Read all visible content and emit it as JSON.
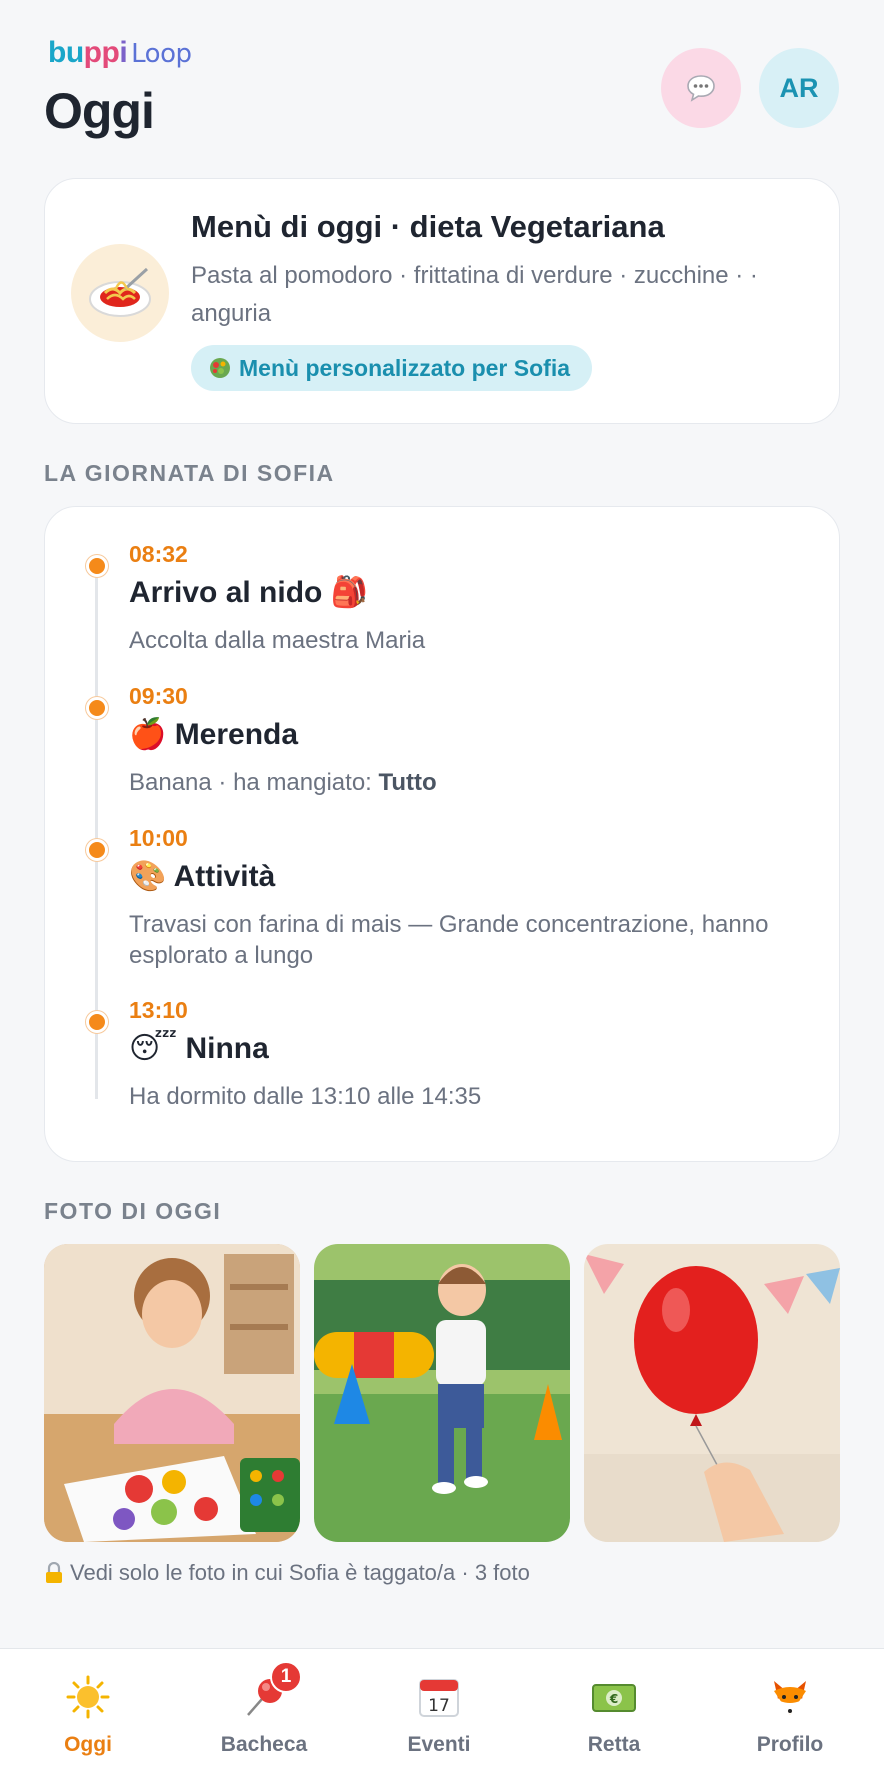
{
  "header": {
    "brand_part1": "bu",
    "brand_part2": "pp",
    "brand_part3": "i",
    "brand_loop": "Loop",
    "title": "Oggi",
    "avatar_initials": "AR",
    "chat_icon": "speech-bubble-icon"
  },
  "menu": {
    "title": "Menù di oggi · dieta Vegetariana",
    "items": "Pasta al pomodoro · frittatina di verdure · zucchine · · anguria",
    "personalized_label": "Menù personalizzato per Sofia",
    "food_icon": "spaghetti-icon"
  },
  "timeline": {
    "section_label": "LA GIORNATA DI SOFIA",
    "entries": [
      {
        "time": "08:32",
        "title": "Arrivo al nido 🎒",
        "desc": "Accolta dalla maestra Maria"
      },
      {
        "time": "09:30",
        "title": "🍎 Merenda",
        "desc_prefix": "Banana · ha mangiato: ",
        "desc_bold": "Tutto"
      },
      {
        "time": "10:00",
        "title": "🎨 Attività",
        "desc": "Travasi con farina di mais — Grande concentrazione, hanno esplorato a lungo"
      },
      {
        "time": "13:10",
        "title": "😴 Ninna",
        "desc": "Ha dormito dalle 13:10 alle 14:35"
      }
    ]
  },
  "photos": {
    "section_label": "FOTO DI OGGI",
    "items": [
      "painting-photo",
      "running-photo",
      "balloon-photo"
    ],
    "note": "Vedi solo le foto in cui Sofia è taggato/a · 3 foto"
  },
  "nav": {
    "items": [
      {
        "label": "Oggi",
        "icon": "sun-icon",
        "active": true
      },
      {
        "label": "Bacheca",
        "icon": "pushpin-icon",
        "badge": "1"
      },
      {
        "label": "Eventi",
        "icon": "calendar-icon",
        "calendar_day": "17"
      },
      {
        "label": "Retta",
        "icon": "money-icon"
      },
      {
        "label": "Profilo",
        "icon": "fox-icon"
      }
    ]
  },
  "colors": {
    "accent_orange": "#ea7f12",
    "accent_teal": "#1a8fae",
    "background": "#f6f7f9"
  }
}
